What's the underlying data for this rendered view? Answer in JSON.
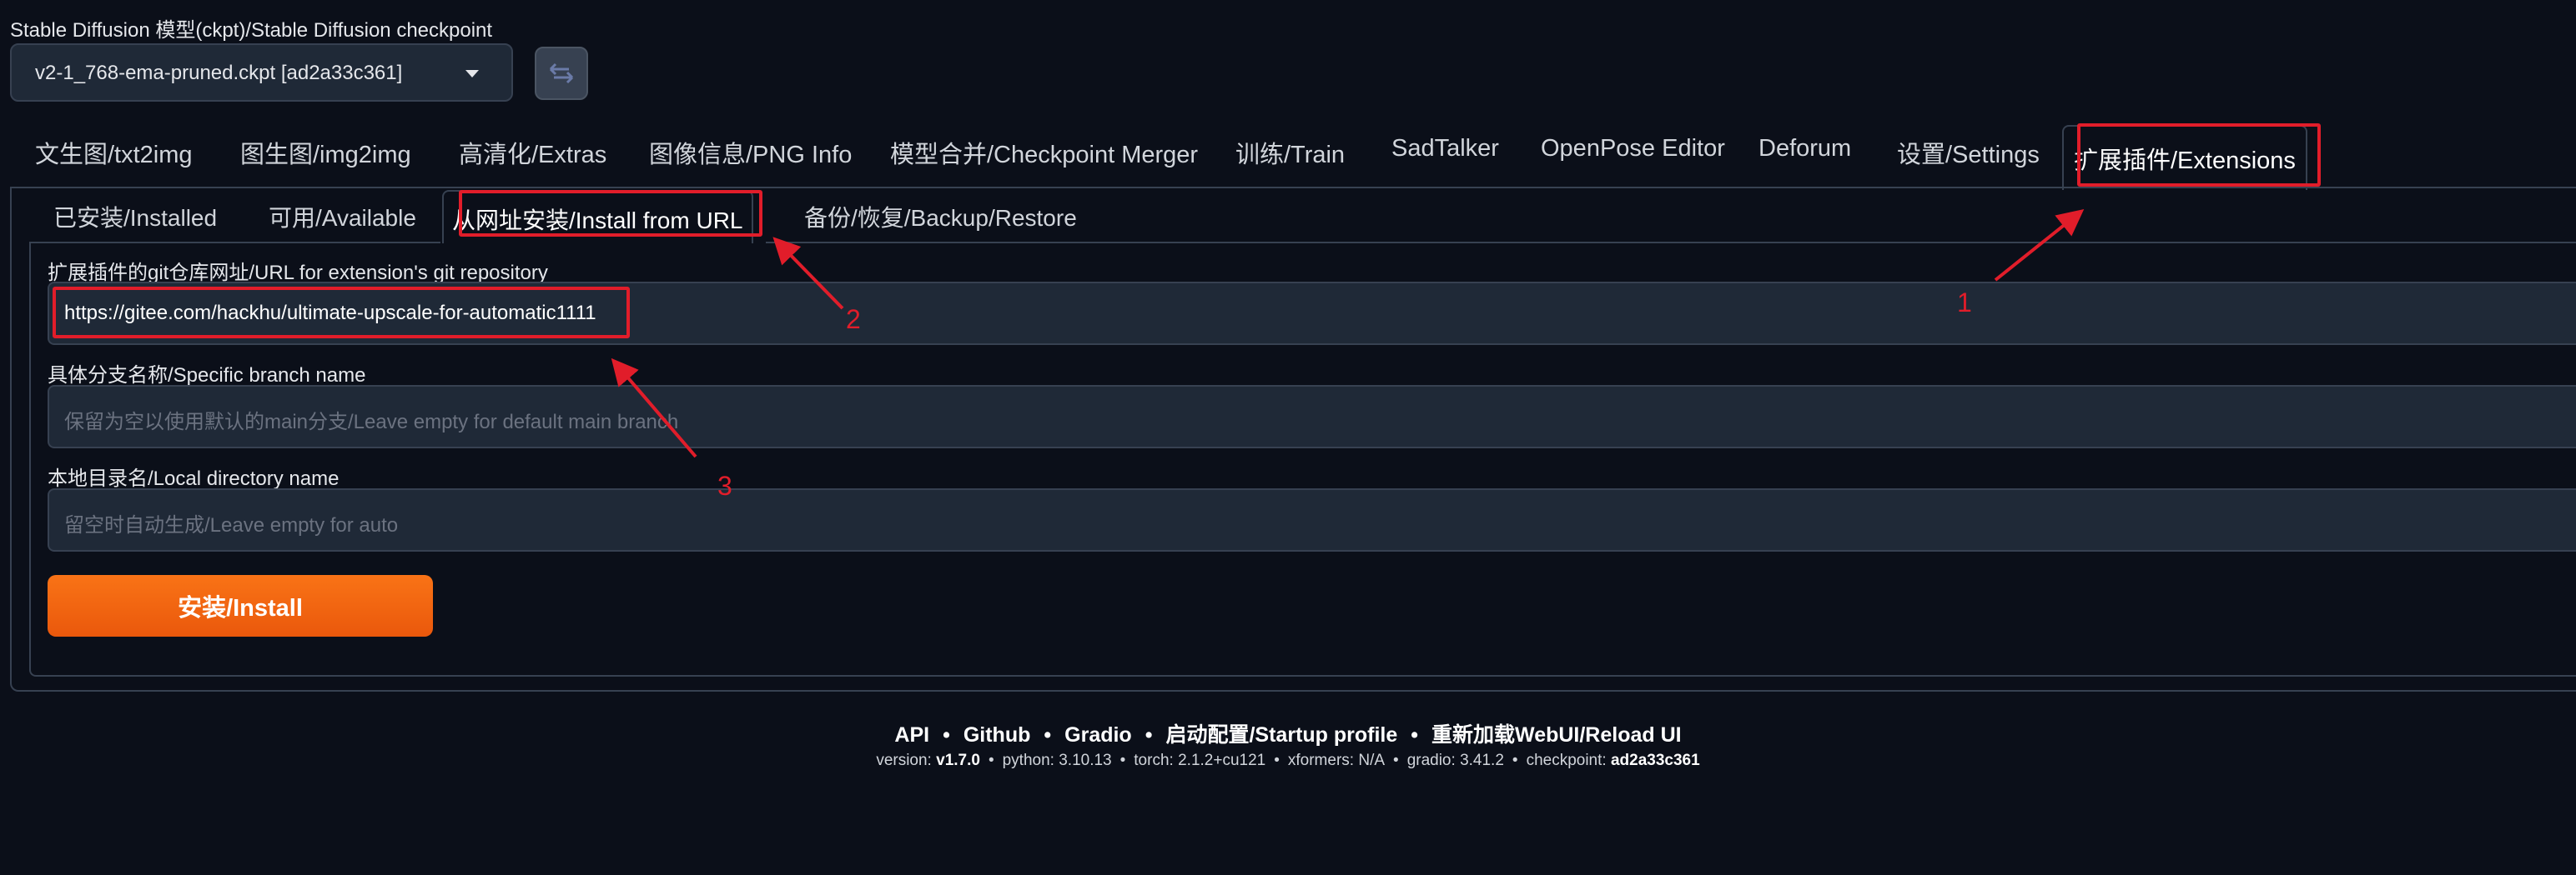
{
  "checkpoint": {
    "label": "Stable Diffusion 模型(ckpt)/Stable Diffusion checkpoint",
    "selected": "v2-1_768-ema-pruned.ckpt [ad2a33c361]",
    "refresh_icon": "refresh-icon"
  },
  "main_tabs": [
    {
      "label": "文生图/txt2img"
    },
    {
      "label": "图生图/img2img"
    },
    {
      "label": "高清化/Extras"
    },
    {
      "label": "图像信息/PNG Info"
    },
    {
      "label": "模型合并/Checkpoint Merger"
    },
    {
      "label": "训练/Train"
    },
    {
      "label": "SadTalker"
    },
    {
      "label": "OpenPose Editor"
    },
    {
      "label": "Deforum"
    },
    {
      "label": "设置/Settings"
    },
    {
      "label": "扩展插件/Extensions",
      "active": true
    }
  ],
  "sub_tabs": [
    {
      "label": "已安装/Installed"
    },
    {
      "label": "可用/Available"
    },
    {
      "label": "从网址安装/Install from URL",
      "active": true
    },
    {
      "label": "备份/恢复/Backup/Restore"
    }
  ],
  "form": {
    "url_label": "扩展插件的git仓库网址/URL for extension's git repository",
    "url_value": "https://gitee.com/hackhu/ultimate-upscale-for-automatic1111",
    "branch_label": "具体分支名称/Specific branch name",
    "branch_placeholder": "保留为空以使用默认的main分支/Leave empty for default main branch",
    "dir_label": "本地目录名/Local directory name",
    "dir_placeholder": "留空时自动生成/Leave empty for auto",
    "install_button": "安装/Install"
  },
  "footer": {
    "links": [
      "API",
      "Github",
      "Gradio",
      "启动配置/Startup profile",
      "重新加载WebUI/Reload UI"
    ],
    "versions": [
      {
        "key": "version:",
        "value": "v1.7.0",
        "bold": true
      },
      {
        "key": "python:",
        "value": "3.10.13"
      },
      {
        "key": "torch:",
        "value": "2.1.2+cu121"
      },
      {
        "key": "xformers:",
        "value": "N/A"
      },
      {
        "key": "gradio:",
        "value": "3.41.2"
      },
      {
        "key": "checkpoint:",
        "value": "ad2a33c361",
        "bold": true
      }
    ]
  },
  "annotations": {
    "color": "#e11d2a",
    "labels": [
      "1",
      "2",
      "3"
    ]
  }
}
